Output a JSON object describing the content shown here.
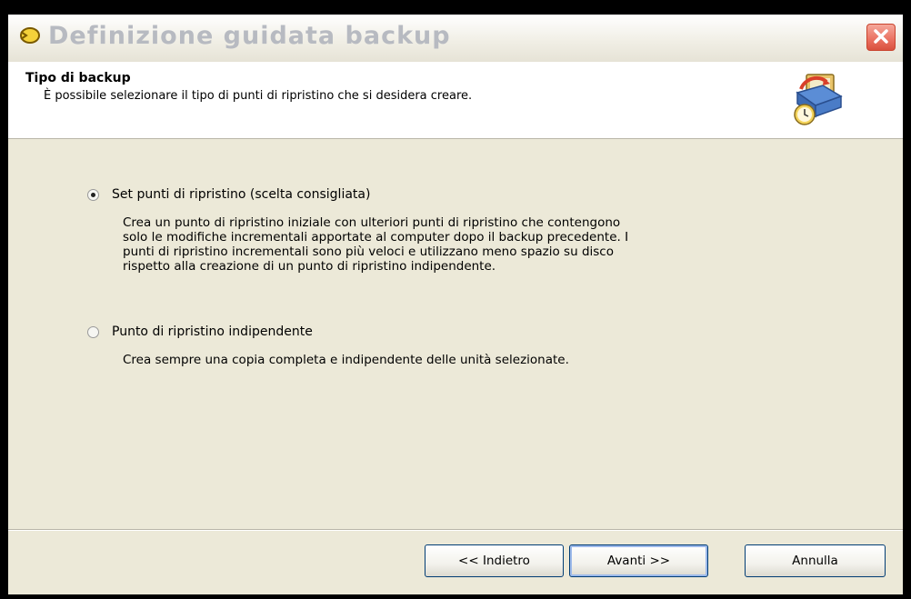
{
  "window": {
    "title": "Definizione guidata backup"
  },
  "header": {
    "title": "Tipo di backup",
    "description": "È possibile selezionare il tipo di punti di ripristino che si desidera creare."
  },
  "options": [
    {
      "label": "Set punti di ripristino (scelta consigliata)",
      "selected": true,
      "description_lines": [
        "Crea un punto di ripristino iniziale con ulteriori punti di ripristino che contengono",
        "solo le modifiche incrementali apportate al computer dopo il backup precedente. I",
        "punti di ripristino incrementali sono più veloci e utilizzano meno spazio su disco",
        "rispetto alla creazione di un punto di ripristino indipendente."
      ]
    },
    {
      "label": "Punto di ripristino indipendente",
      "selected": false,
      "description_lines": [
        "Crea sempre una copia completa e indipendente delle unità selezionate."
      ]
    }
  ],
  "buttons": {
    "back": "<< Indietro",
    "next": "Avanti >>",
    "cancel": "Annulla"
  },
  "icons": {
    "title": "wizard-icon",
    "close": "close-icon",
    "header": "backup-clock-icon"
  },
  "colors": {
    "window_bg": "#ece9d8",
    "header_bg": "#ffffff",
    "close_button": "#ea7060",
    "title_text": "#b7bac1"
  }
}
